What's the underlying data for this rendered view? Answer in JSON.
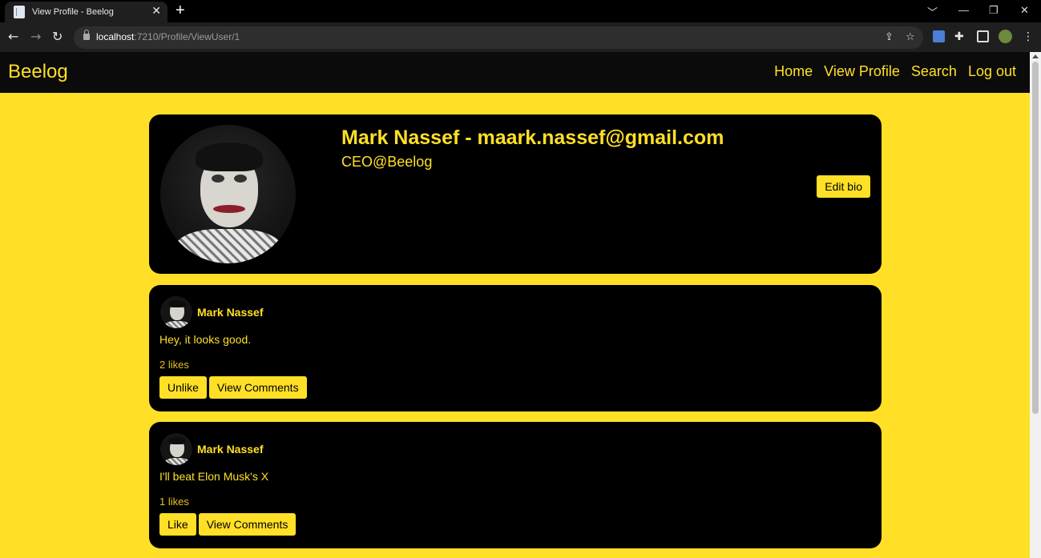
{
  "browser": {
    "tab_title": "View Profile - Beelog",
    "tab_close": "✕",
    "new_tab": "+",
    "url_host": "localhost",
    "url_path": ":7210/Profile/ViewUser/1",
    "window_controls": [
      "﹀",
      "—",
      "❐",
      "✕"
    ]
  },
  "app": {
    "brand": "Beelog",
    "nav": [
      "Home",
      "View Profile",
      "Search",
      "Log out"
    ],
    "accent": "#ffe026"
  },
  "profile": {
    "title": "Mark Nassef - maark.nassef@gmail.com",
    "bio": "CEO@Beelog",
    "edit_bio_label": "Edit bio"
  },
  "posts": [
    {
      "author": "Mark Nassef",
      "text": "Hey, it looks good.",
      "likes": "2 likes",
      "like_label": "Unlike",
      "comments_label": "View Comments"
    },
    {
      "author": "Mark Nassef",
      "text": "I'll beat Elon Musk's X",
      "likes": "1 likes",
      "like_label": "Like",
      "comments_label": "View Comments"
    }
  ]
}
